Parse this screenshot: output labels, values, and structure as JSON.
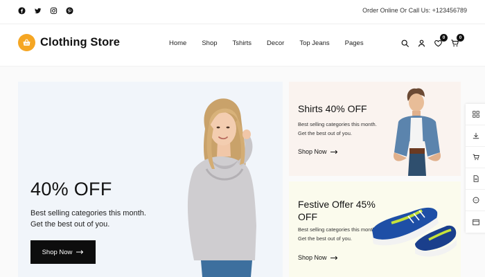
{
  "topbar": {
    "social_icons": [
      "facebook-icon",
      "twitter-icon",
      "instagram-icon",
      "pinterest-icon"
    ],
    "contact_text": "Order Online Or Call Us: +123456789"
  },
  "header": {
    "brand_name": "Clothing Store",
    "logo_icon": "basket-icon",
    "nav": [
      "Home",
      "Shop",
      "Tshirts",
      "Decor",
      "Top Jeans",
      "Pages"
    ],
    "wishlist_count": "0",
    "cart_count": "0"
  },
  "hero": {
    "title": "40% OFF",
    "text": "Best selling categories this month. Get the best out of you.",
    "button_label": "Shop Now"
  },
  "promos": [
    {
      "title": "Shirts 40% OFF",
      "text": "Best selling categories this month. Get the best out of you.",
      "link_label": "Shop Now"
    },
    {
      "title": "Festive Offer 45% OFF",
      "text": "Best selling categories this month. Get the best out of you.",
      "link_label": "Shop Now"
    }
  ],
  "side_rail": [
    "grid-icon",
    "download-icon",
    "cart-icon",
    "document-icon",
    "chat-icon",
    "window-icon"
  ],
  "colors": {
    "accent": "#f5a623",
    "hero_bg": "#f1f5fa",
    "promo1_bg": "#faf3ef",
    "promo2_bg": "#fbfbed",
    "button_bg": "#0d0d0d"
  }
}
